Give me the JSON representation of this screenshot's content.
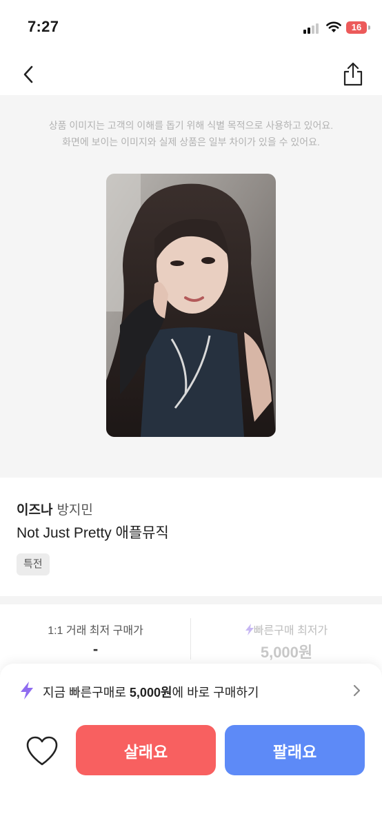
{
  "status_bar": {
    "time": "7:27",
    "battery": "16"
  },
  "notice": {
    "line1": "상품 이미지는 고객의 이해를 돕기 위해 식별 목적으로 사용하고 있어요.",
    "line2": "화면에 보이는 이미지와 실제 상품은 일부 차이가 있을 수 있어요."
  },
  "product": {
    "group": "이즈나",
    "member": "방지민",
    "title": "Not Just Pretty 애플뮤직",
    "tag": "특전"
  },
  "prices": {
    "direct_label": "1:1 거래 최저 구매가",
    "direct_value": "-",
    "quick_label": "빠른구매 최저가",
    "quick_value": "5,000원"
  },
  "quick_buy": {
    "prefix": "지금 빠른구매로 ",
    "amount": "5,000원",
    "suffix": "에 바로 구매하기"
  },
  "actions": {
    "buy": "살래요",
    "sell": "팔래요"
  },
  "colors": {
    "buy": "#f86060",
    "sell": "#5d8af7",
    "bolt": "#8f6cf0",
    "bolt_light": "#c7b7f3",
    "battery": "#ec5a5a"
  },
  "icons": [
    "back-arrow-icon",
    "share-icon",
    "lightning-icon",
    "chevron-right-icon",
    "heart-icon"
  ]
}
